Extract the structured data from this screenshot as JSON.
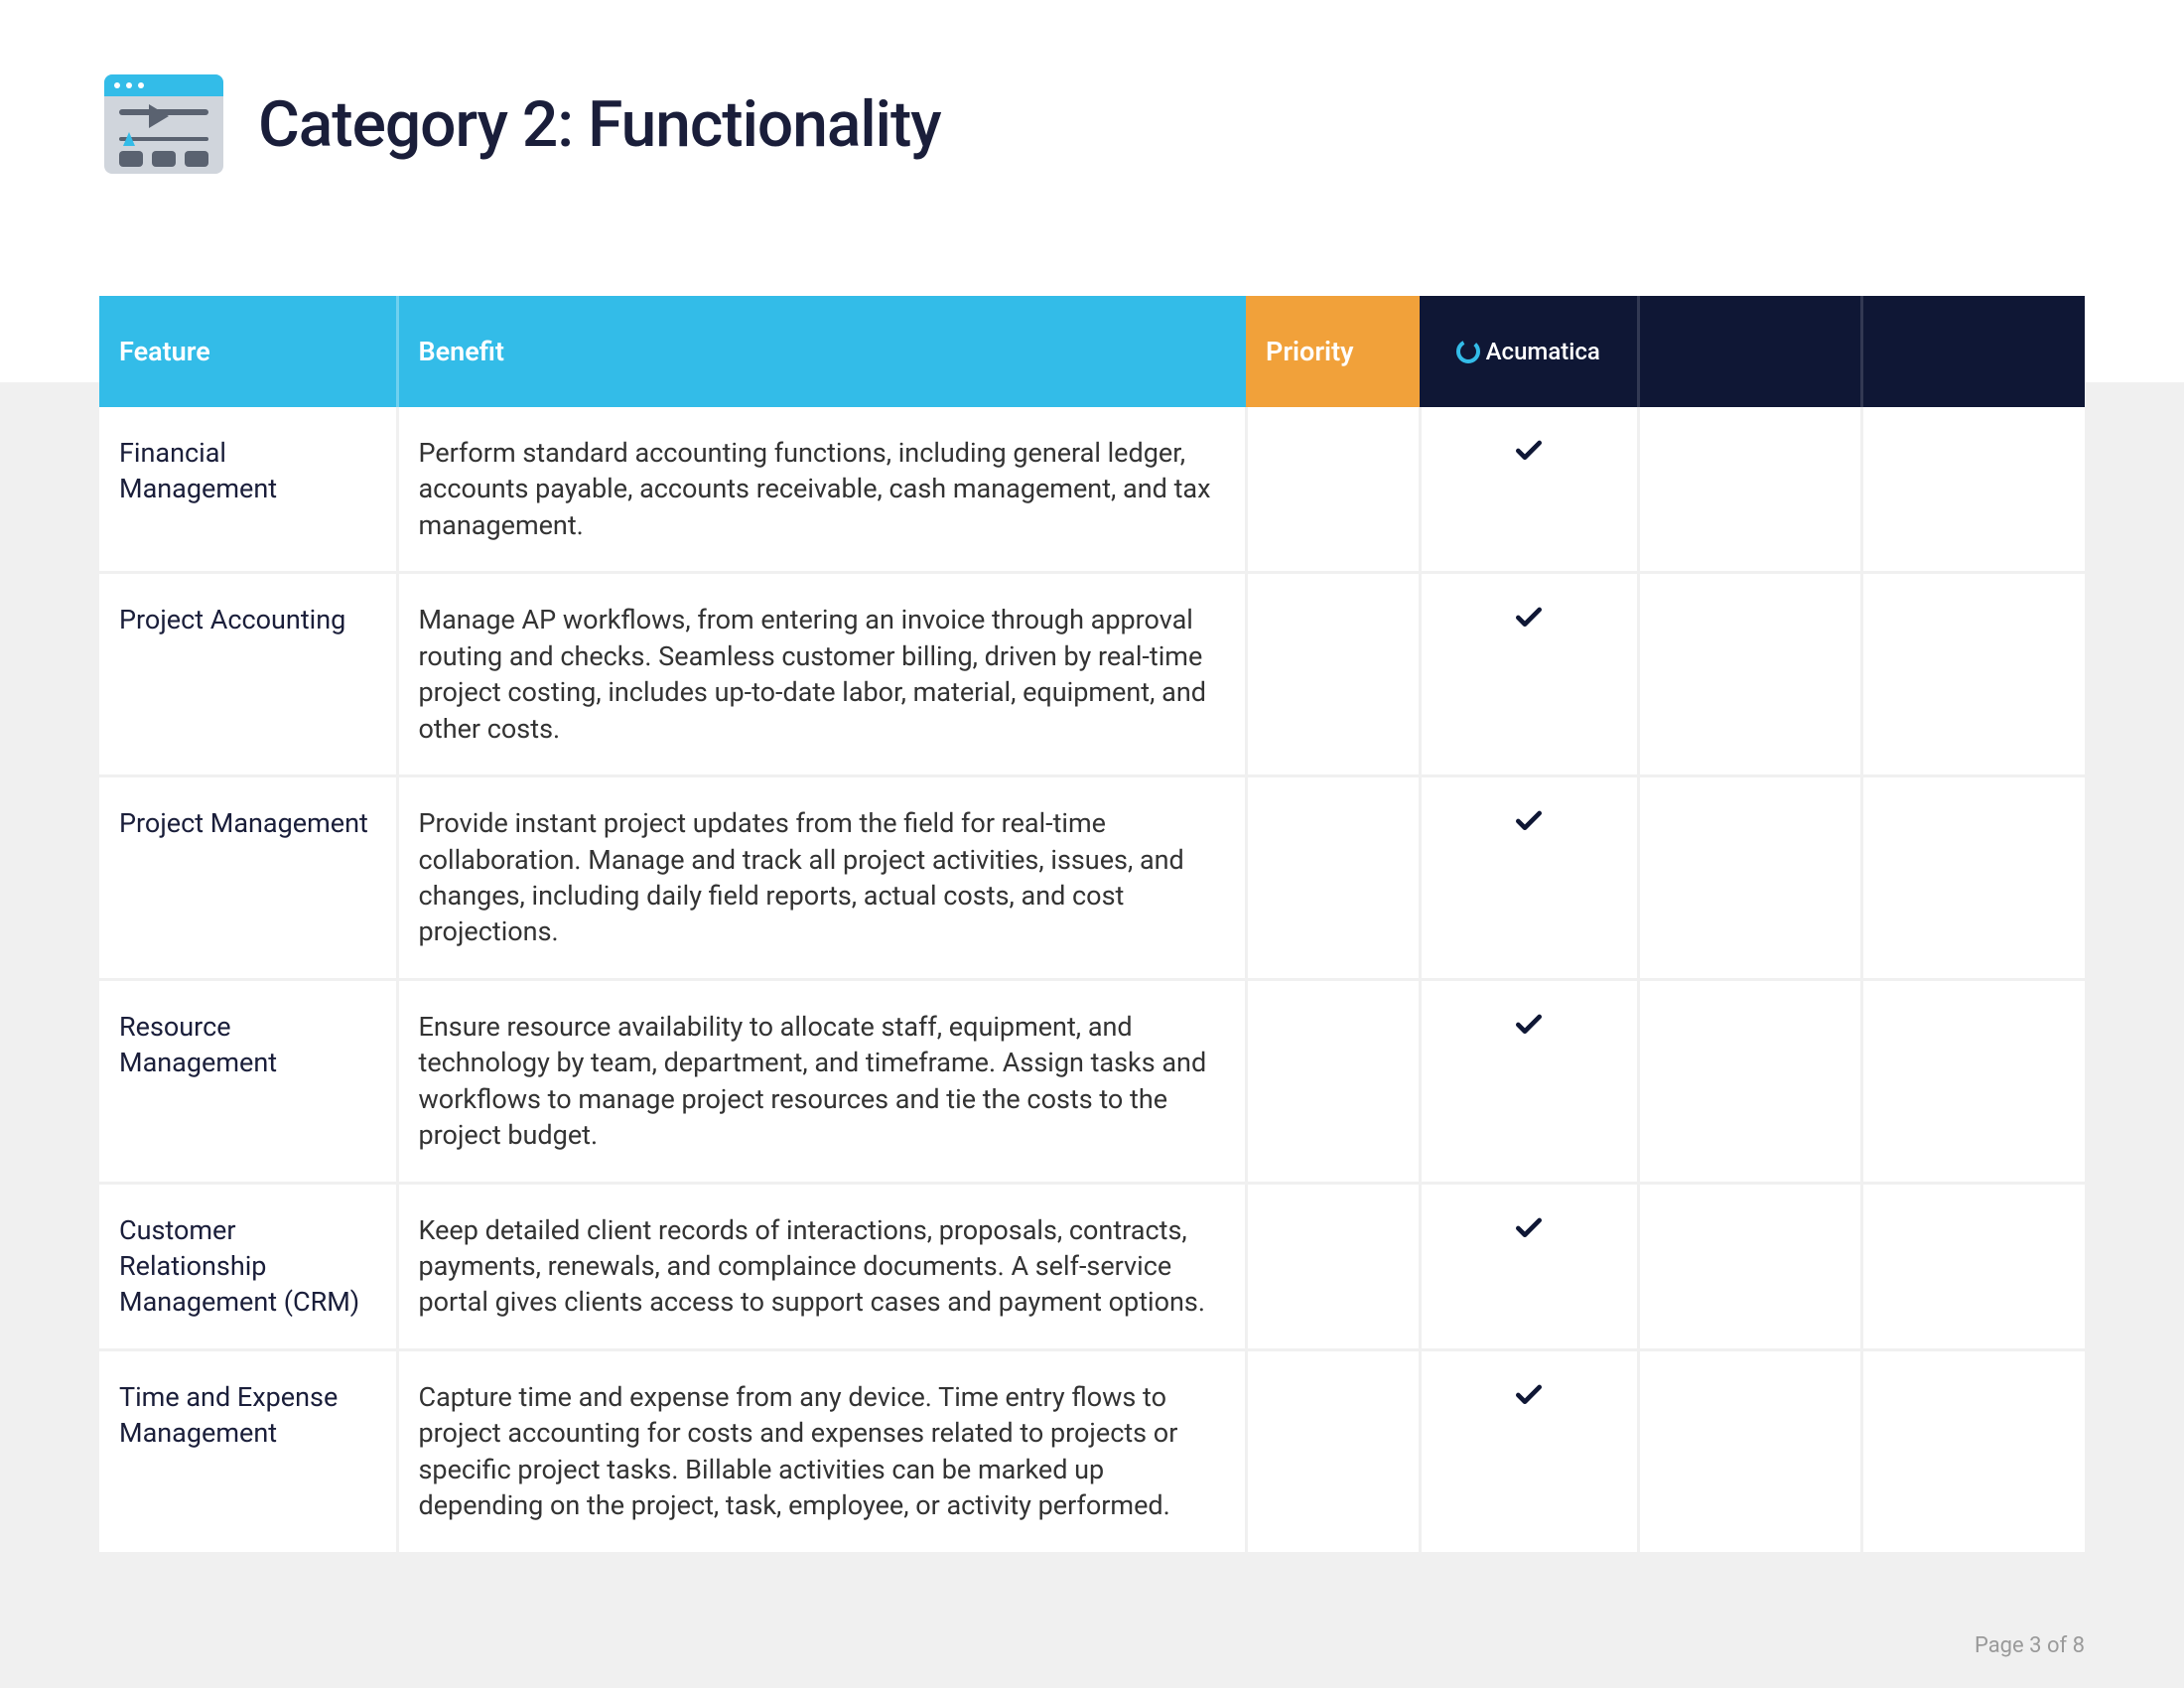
{
  "title": "Category 2: Functionality",
  "footer": "Page 3 of 8",
  "headers": {
    "feature": "Feature",
    "benefit": "Benefit",
    "priority": "Priority",
    "vendor1": "Acumatica"
  },
  "rows": [
    {
      "feature": "Financial Management",
      "benefit": "Perform standard accounting functions, including general ledger, accounts payable, accounts receivable, cash management, and tax management.",
      "vendor1_check": true
    },
    {
      "feature": "Project Accounting",
      "benefit": "Manage AP workflows, from entering an invoice through approval routing and checks. Seamless customer billing, driven by real-time project costing, includes up-to-date labor, material, equipment, and other costs.",
      "vendor1_check": true
    },
    {
      "feature": "Project Management",
      "benefit": "Provide instant project updates from the field for real-time collaboration. Manage and track all project activities, issues, and changes, including daily field reports, actual costs, and cost projections.",
      "vendor1_check": true
    },
    {
      "feature": "Resource Management",
      "benefit": "Ensure resource availability to allocate staff, equipment, and technology by team, department, and timeframe. Assign tasks and workflows to manage project resources and tie the costs to the project budget.",
      "vendor1_check": true
    },
    {
      "feature": "Customer Relationship Management (CRM)",
      "benefit": "Keep detailed client records of interactions, proposals, contracts, payments, renewals, and complaince documents. A self-service portal gives clients access to support cases and payment options.",
      "vendor1_check": true
    },
    {
      "feature": "Time and Expense Management",
      "benefit": "Capture time and expense from any device. Time entry flows to project accounting for costs and expenses related to projects or specific project tasks. Billable activities can be marked up depending on the project, task, employee, or activity performed.",
      "vendor1_check": true
    }
  ]
}
